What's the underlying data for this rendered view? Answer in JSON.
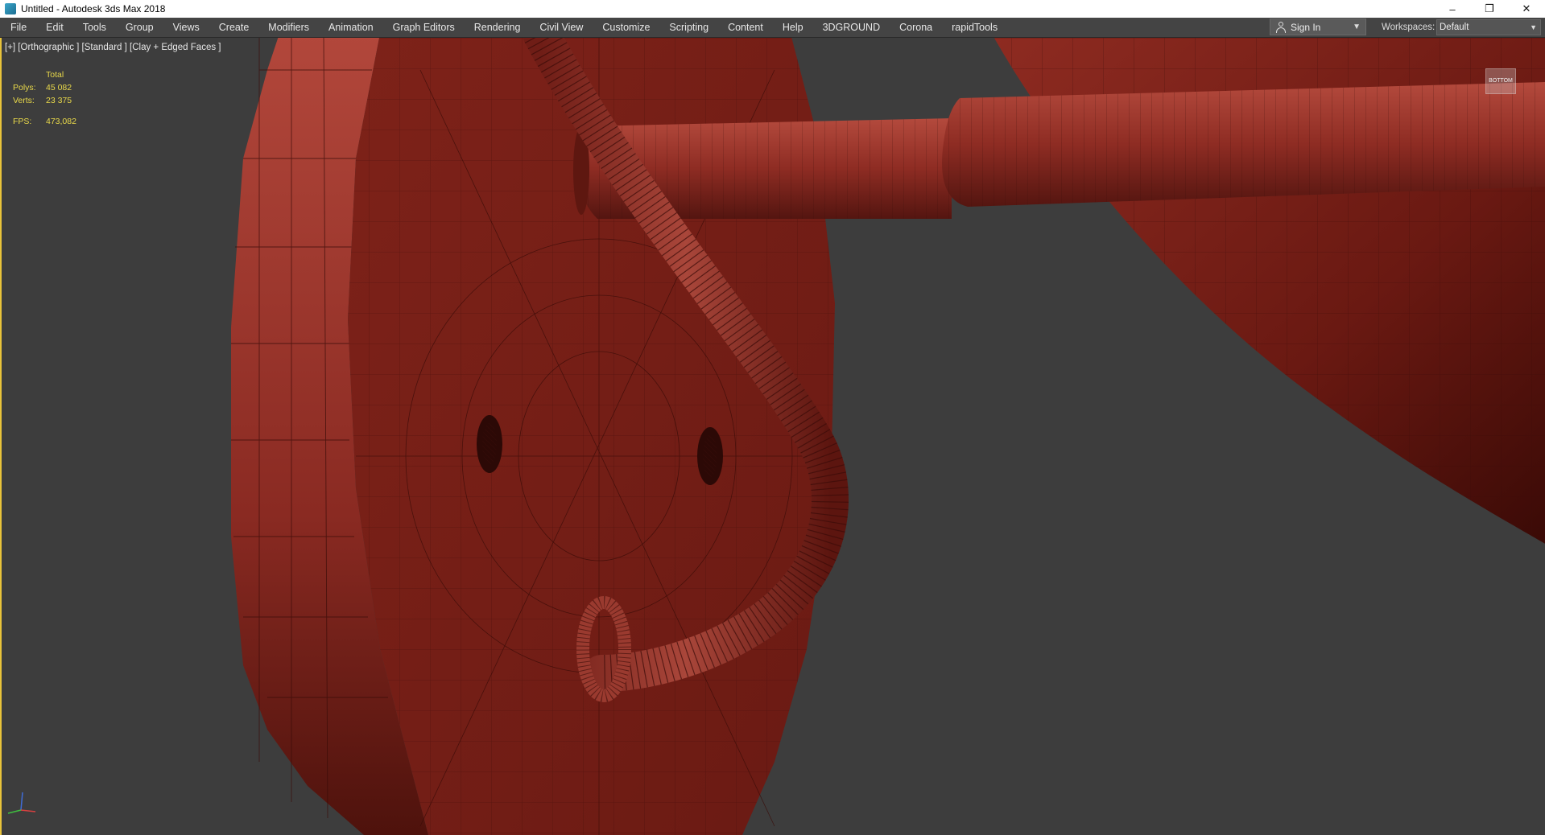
{
  "window": {
    "title": "Untitled - Autodesk 3ds Max 2018",
    "controls": {
      "minimize": "–",
      "restore": "❐",
      "close": "✕"
    }
  },
  "menubar": {
    "items": [
      "File",
      "Edit",
      "Tools",
      "Group",
      "Views",
      "Create",
      "Modifiers",
      "Animation",
      "Graph Editors",
      "Rendering",
      "Civil View",
      "Customize",
      "Scripting",
      "Content",
      "Help",
      "3DGROUND",
      "Corona",
      "rapidTools"
    ],
    "sign_in": "Sign In",
    "workspaces_label": "Workspaces:",
    "workspaces_value": "Default"
  },
  "viewport": {
    "label": "[+] [Orthographic ] [Standard ] [Clay + Edged Faces ]",
    "stats": {
      "header": "Total",
      "rows": [
        {
          "key": "Polys:",
          "value": "45 082"
        },
        {
          "key": "Verts:",
          "value": "23 375"
        },
        {
          "key": "FPS:",
          "value": "473,082"
        }
      ]
    },
    "navcube_label": "BOTTOM"
  },
  "colors": {
    "clay": "#8a2a22",
    "clay_light": "#a8463a",
    "clay_dark": "#5a150f",
    "wire": "#3a0c08",
    "background": "#3d3d3d",
    "stats_text": "#e9d94a",
    "active_border": "#e8c33a"
  }
}
